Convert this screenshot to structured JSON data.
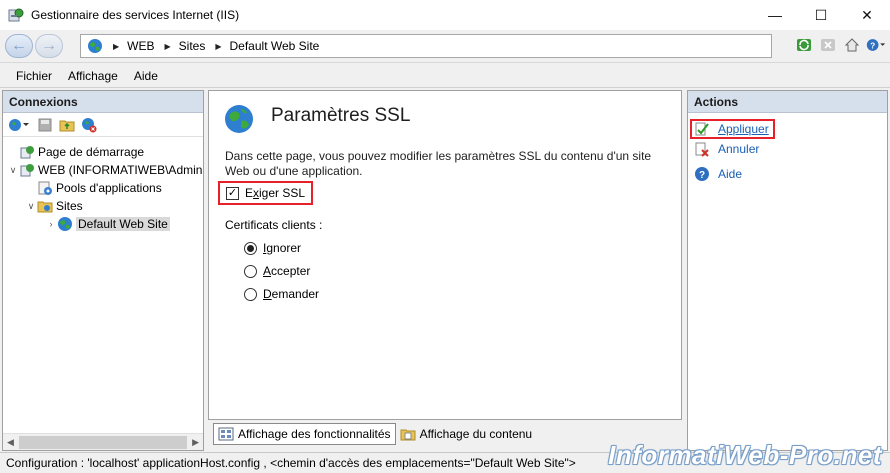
{
  "window": {
    "title": "Gestionnaire des services Internet (IIS)"
  },
  "addressbar": {
    "crumbs": [
      "WEB",
      "Sites",
      "Default Web Site"
    ]
  },
  "menu": [
    "Fichier",
    "Affichage",
    "Aide"
  ],
  "connections": {
    "title": "Connexions",
    "tree": [
      {
        "label": "Page de démarrage",
        "icon": "start-page-icon",
        "indent": 0,
        "twisty": ""
      },
      {
        "label": "WEB (INFORMATIWEB\\Admin",
        "icon": "server-icon",
        "indent": 0,
        "twisty": "expanded"
      },
      {
        "label": "Pools d'applications",
        "icon": "app-pools-icon",
        "indent": 1,
        "twisty": ""
      },
      {
        "label": "Sites",
        "icon": "sites-folder-icon",
        "indent": 1,
        "twisty": "expanded"
      },
      {
        "label": "Default Web Site",
        "icon": "globe-icon",
        "indent": 2,
        "twisty": "collapsed",
        "selected": true
      }
    ]
  },
  "main": {
    "title": "Paramètres SSL",
    "description": "Dans cette page, vous pouvez modifier les paramètres SSL du contenu d'un site Web ou d'une application.",
    "require_ssl": {
      "prefix": "E",
      "underlined": "x",
      "rest": "iger SSL",
      "checked": true
    },
    "client_certs_label": "Certificats clients :",
    "radios": [
      {
        "underlined": "I",
        "rest": "gnorer",
        "selected": true
      },
      {
        "underlined": "A",
        "rest": "ccepter",
        "selected": false
      },
      {
        "underlined": "D",
        "rest": "emander",
        "selected": false
      }
    ]
  },
  "bottom_tabs": {
    "features": "Affichage des fonctionnalités",
    "content": "Affichage du contenu"
  },
  "actions": {
    "title": "Actions",
    "items": [
      {
        "label": "Appliquer",
        "icon": "apply-checkmark-icon"
      },
      {
        "label": "Annuler",
        "icon": "cancel-x-icon"
      },
      {
        "label": "Aide",
        "icon": "help-icon"
      }
    ]
  },
  "statusbar": {
    "text": "Configuration : 'localhost' applicationHost.config , <chemin d'accès des emplacements=\"Default Web Site\">"
  },
  "watermark": "InformatiWeb-Pro.net",
  "colors": {
    "highlight_border": "#e8202a",
    "panel_header": "#d6dfec",
    "link": "#1a5fb4"
  }
}
